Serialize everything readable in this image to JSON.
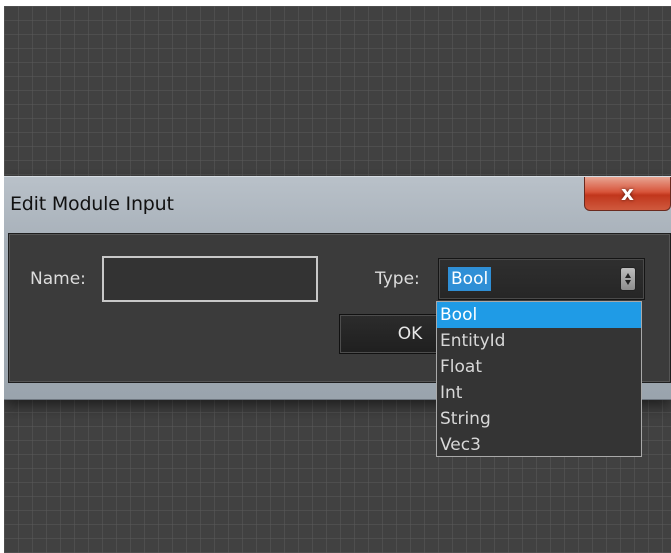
{
  "dialog": {
    "title": "Edit Module Input",
    "close_label": "x"
  },
  "form": {
    "name_label": "Name:",
    "name_value": "",
    "type_label": "Type:",
    "type_selected": "Bool",
    "ok_label": "OK"
  },
  "type_options": [
    "Bool",
    "EntityId",
    "Float",
    "Int",
    "String",
    "Vec3"
  ],
  "colors": {
    "selection": "#1f9be6",
    "close_button": "#d8553b",
    "canvas_background": "#414141"
  }
}
